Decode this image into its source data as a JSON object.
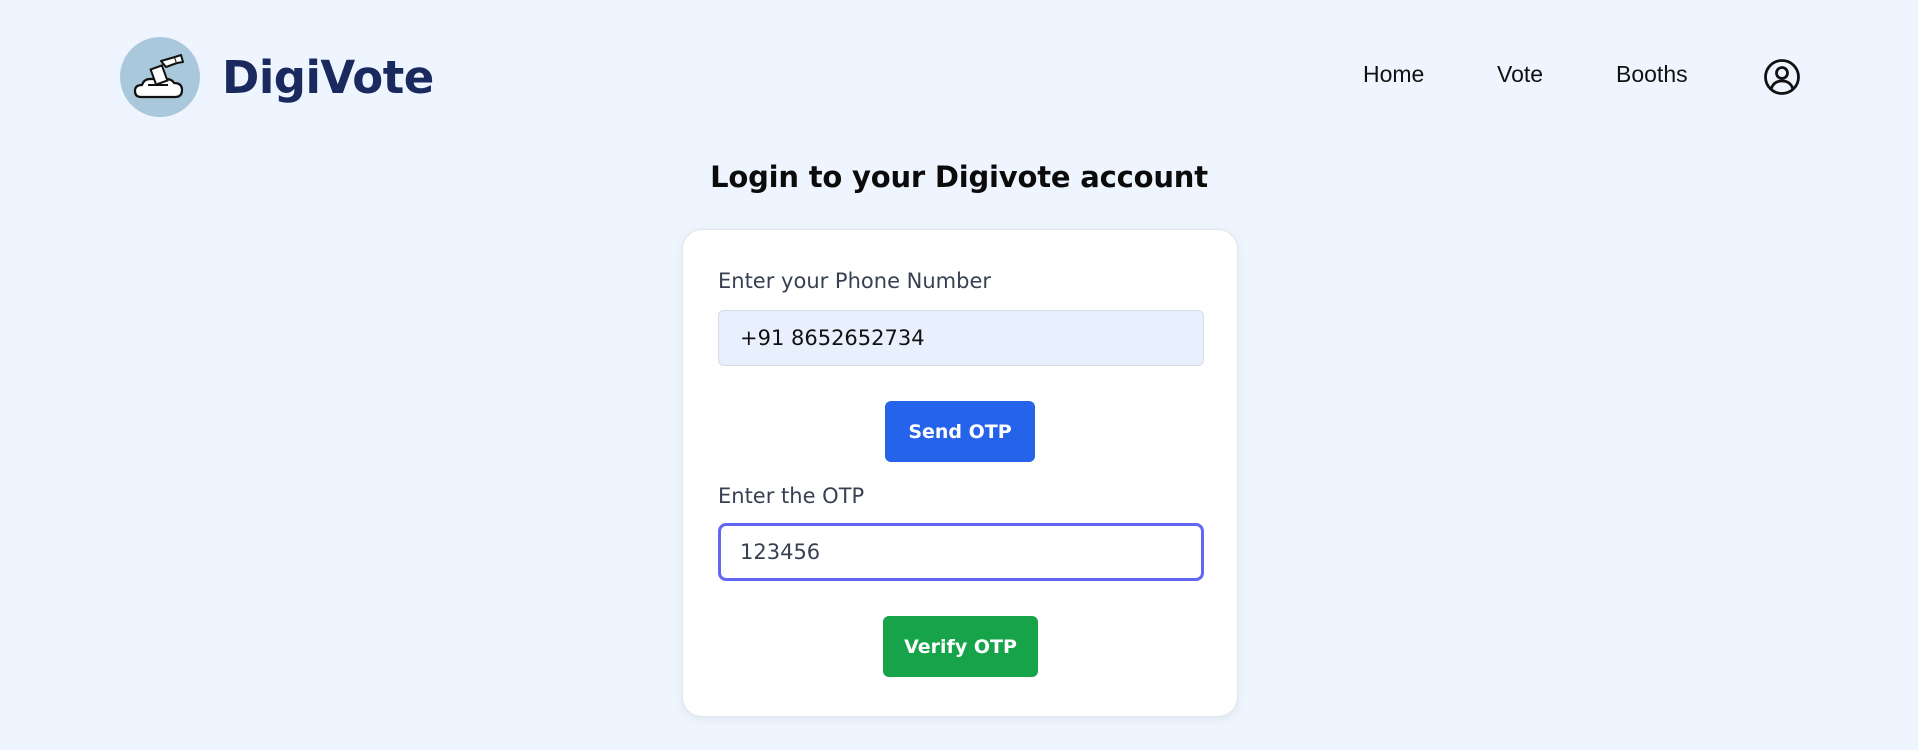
{
  "brand": {
    "name": "DigiVote",
    "logo_icon": "ballot-box-icon",
    "logo_bg": "#a9c8dc",
    "name_color": "#1b2a5e"
  },
  "nav": {
    "items": [
      {
        "label": "Home"
      },
      {
        "label": "Vote"
      },
      {
        "label": "Booths"
      }
    ],
    "profile_icon": "user-circle-icon"
  },
  "page": {
    "title": "Login to your Digivote account",
    "background": "#eef5ff"
  },
  "login_form": {
    "phone_label": "Enter your Phone Number",
    "phone_value": "+91 8652652734",
    "send_button": "Send OTP",
    "otp_label": "Enter the OTP",
    "otp_value": "123456",
    "verify_button": "Verify OTP"
  },
  "colors": {
    "send_button": "#2563eb",
    "verify_button": "#16a34a",
    "otp_focus_border": "#6366f1"
  }
}
